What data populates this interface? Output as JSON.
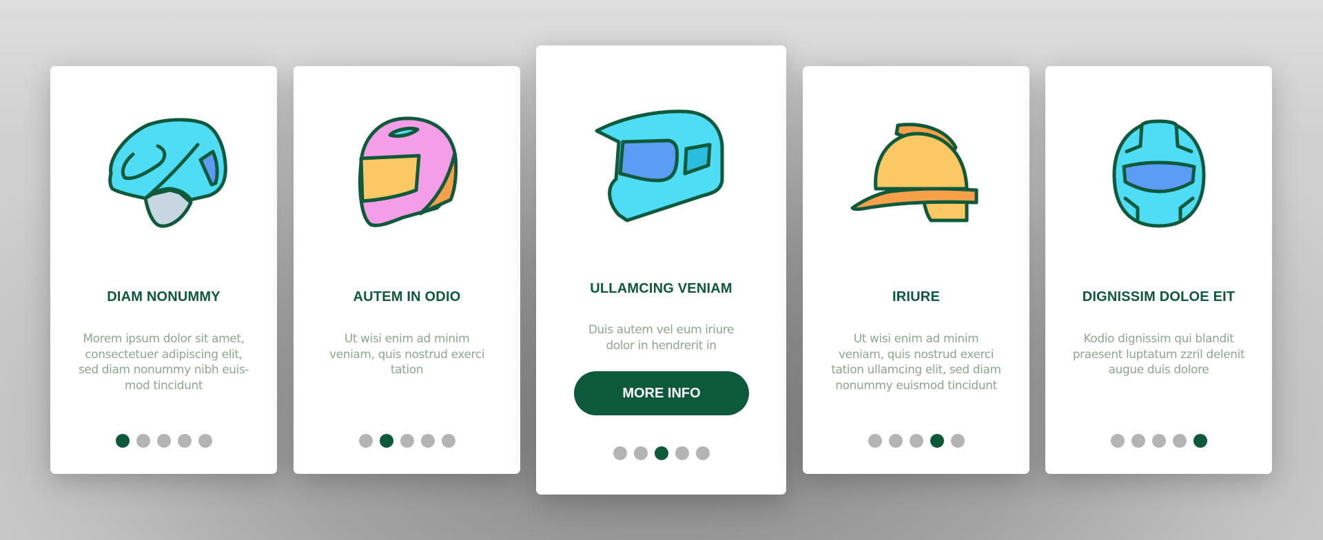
{
  "colors": {
    "accent": "#0d5a3a",
    "body_text": "#8fa68f",
    "dot_inactive": "#b4b4b4",
    "helmet_cyan": "#4fdcf5",
    "helmet_blue": "#5b9cf5",
    "helmet_pink": "#f59ee8",
    "helmet_yellow": "#fcc864",
    "helmet_orange": "#f7a04a",
    "helmet_gray": "#c8d6e2"
  },
  "screens": [
    {
      "icon": "bicycle-helmet-icon",
      "title": "DIAM NONUMMY",
      "body": [
        "Morem ipsum dolor sit amet,",
        "consectetuer adipiscing elit,",
        "sed diam nonummy nibh euis-",
        "mod tincidunt"
      ],
      "active_dot": 1
    },
    {
      "icon": "motorcycle-helmet-icon",
      "title": "AUTEM IN ODIO",
      "body": [
        "Ut wisi enim ad minim",
        "veniam, quis nostrud exerci",
        "tation"
      ],
      "active_dot": 2
    },
    {
      "icon": "motocross-helmet-icon",
      "title": "ULLAMCING VENIAM",
      "body": [
        "Duis autem vel eum iriure",
        "dolor in hendrerit in"
      ],
      "button": "MORE INFO",
      "active_dot": 3
    },
    {
      "icon": "hard-hat-icon",
      "title": "IRIURE",
      "body": [
        "Ut wisi enim ad minim",
        "veniam, quis nostrud exerci",
        "tation ullamcing elit, sed diam",
        "nonummy euismod tincidunt"
      ],
      "active_dot": 4
    },
    {
      "icon": "racing-helmet-front-icon",
      "title": "DIGNISSIM DOLOE EIT",
      "body": [
        "Kodio dignissim qui blandit",
        "praesent luptatum zzril delenit",
        "augue duis dolore"
      ],
      "active_dot": 5
    }
  ],
  "pagination": {
    "total": 5
  }
}
